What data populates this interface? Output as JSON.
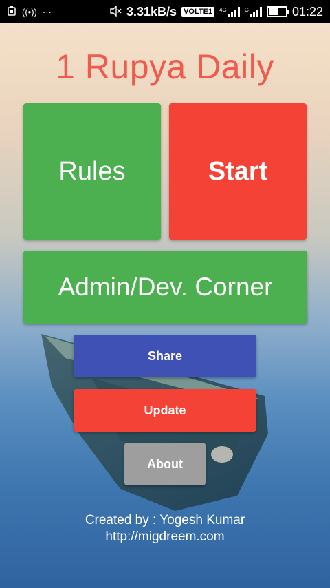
{
  "status_bar": {
    "left_icons": [
      "shield-icon",
      "broadcast-icon",
      "more-icon"
    ],
    "speed": "3.31kB/s",
    "volte": "VOLTE1",
    "network1": "4G",
    "network2": "G",
    "time": "01:22",
    "colors": {
      "background": "#000000",
      "text": "#ffffff"
    }
  },
  "app": {
    "title": "1 Rupya Daily",
    "buttons": {
      "rules": "Rules",
      "start": "Start",
      "admin": "Admin/Dev. Corner",
      "share": "Share",
      "update": "Update",
      "about": "About"
    },
    "credits": {
      "line1": "Created by : Yogesh Kumar",
      "line2": "http://migdreem.com"
    },
    "colors": {
      "title": "#ef5b4e",
      "green": "#4caf50",
      "red": "#f44336",
      "indigo": "#3f51b5",
      "grey": "#9e9e9e"
    }
  }
}
